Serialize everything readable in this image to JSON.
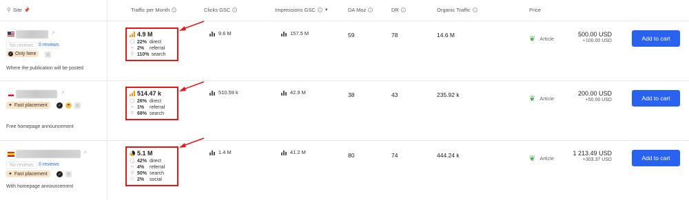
{
  "headers": {
    "site": "Site",
    "traffic": "Traffic per Month",
    "clicks": "Clicks GSC",
    "impressions": "Impressions GSC",
    "da": "DA Moz",
    "dr": "DR",
    "organic": "Organic Traffic",
    "price": "Price"
  },
  "rows": [
    {
      "flag": "us",
      "no_reviews": "No reviews",
      "reviews": "0 reviews",
      "tag": "Only here",
      "description": "Where the publication will be posted",
      "traffic_total": "4.9 M",
      "traffic_lines": [
        {
          "pct": "22%",
          "label": "direct"
        },
        {
          "pct": "2%",
          "label": "referral"
        },
        {
          "pct": "110%",
          "label": "search"
        }
      ],
      "clicks": "9.6 M",
      "impressions": "157.5 M",
      "da": "59",
      "dr": "78",
      "organic": "14.6 M",
      "article": "Article",
      "price": "500.00 USD",
      "price_extra": "+100.00 USD",
      "cart": "Add to cart"
    },
    {
      "flag": "pl",
      "no_reviews": "",
      "reviews": "",
      "tag": "Fast placement",
      "description": "Free homepage announcement",
      "traffic_total": "514.47 k",
      "traffic_lines": [
        {
          "pct": "26%",
          "label": "direct"
        },
        {
          "pct": "1%",
          "label": "referral"
        },
        {
          "pct": "68%",
          "label": "search"
        }
      ],
      "clicks": "510.59 k",
      "impressions": "42.9 M",
      "da": "38",
      "dr": "43",
      "organic": "235.92 k",
      "article": "Article",
      "price": "200.00 USD",
      "price_extra": "+50.00 USD",
      "cart": "Add to cart"
    },
    {
      "flag": "es",
      "no_reviews": "No reviews",
      "reviews": "0 reviews",
      "tag": "Fast placement",
      "description": "With homepage announcement",
      "traffic_total": "5.1 M",
      "traffic_lines": [
        {
          "pct": "42%",
          "label": "direct"
        },
        {
          "pct": "4%",
          "label": "referral"
        },
        {
          "pct": "50%",
          "label": "search"
        },
        {
          "pct": "2%",
          "label": "social"
        }
      ],
      "clicks": "1.4 M",
      "impressions": "41.2 M",
      "da": "80",
      "dr": "74",
      "organic": "444.24 k",
      "article": "Article",
      "price": "1 213.49 USD",
      "price_extra": "+303.37 USD",
      "cart": "Add to cart"
    }
  ]
}
